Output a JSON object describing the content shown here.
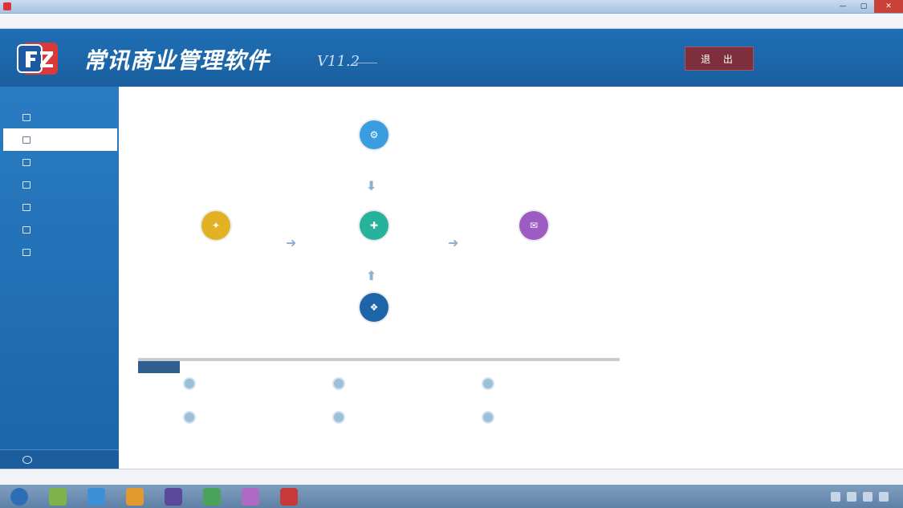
{
  "window": {
    "title": ""
  },
  "menu": [],
  "header": {
    "app_name": "常讯商业管理软件",
    "version": "V11.2",
    "exit_label": "退 出",
    "user_lines": []
  },
  "sidebar": {
    "title": "",
    "items": [
      {
        "label": ""
      },
      {
        "label": ""
      },
      {
        "label": ""
      },
      {
        "label": ""
      },
      {
        "label": ""
      },
      {
        "label": ""
      },
      {
        "label": ""
      }
    ],
    "footer": ""
  },
  "workflow": {
    "nodes": [
      {
        "id": "top",
        "label": "",
        "color": "#3a9de0"
      },
      {
        "id": "left",
        "label": "",
        "color": "#e2b224"
      },
      {
        "id": "center",
        "label": "",
        "color": "#27b39b"
      },
      {
        "id": "right",
        "label": "",
        "color": "#9d5cc4"
      },
      {
        "id": "bottom",
        "label": "",
        "color": "#1e64a8"
      }
    ],
    "arrow_glyph_down": "⬇",
    "arrow_glyph_right": "➜"
  },
  "common": {
    "tab_label": "",
    "shortcuts": [
      {
        "label": ""
      },
      {
        "label": ""
      },
      {
        "label": ""
      },
      {
        "label": ""
      },
      {
        "label": ""
      },
      {
        "label": ""
      }
    ]
  },
  "status": [],
  "taskbar": {
    "clock": "",
    "colors": [
      "#2d6fb7",
      "#7fb34a",
      "#3d8fd6",
      "#e29a2f",
      "#5b4a9a",
      "#4aa35a",
      "#b06ac6",
      "#c83a3a"
    ]
  }
}
